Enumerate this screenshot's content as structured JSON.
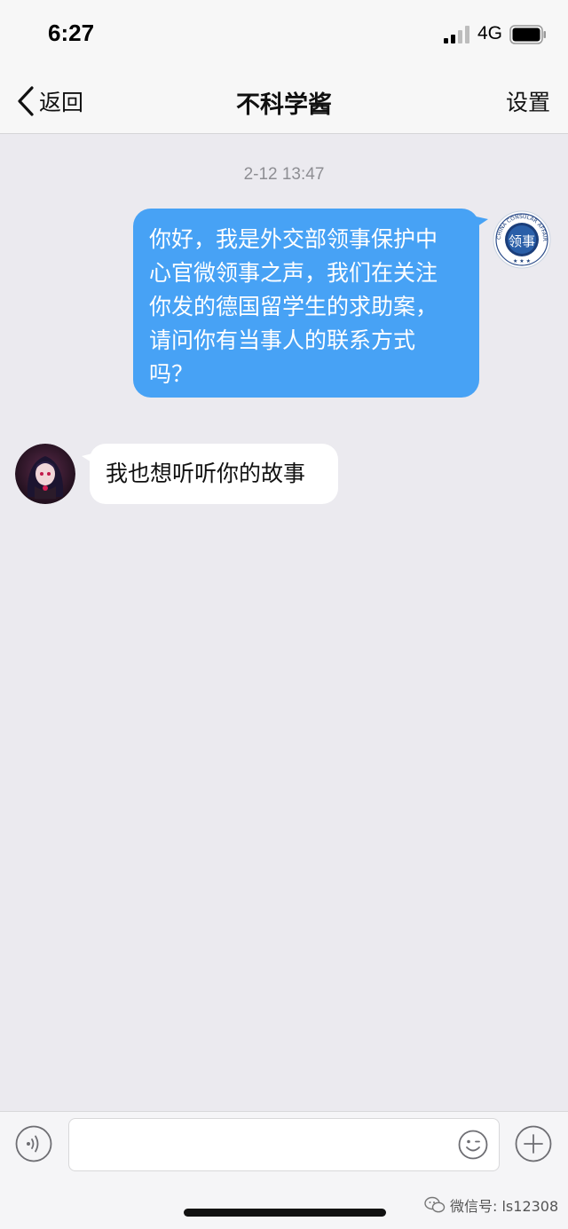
{
  "status_bar": {
    "time": "6:27",
    "network": "4G",
    "signal_icon": "signal-bars-icon",
    "battery_icon": "battery-icon"
  },
  "nav": {
    "back_label": "返回",
    "title": "不科学酱",
    "settings_label": "设置"
  },
  "chat": {
    "timestamp": "2-12 13:47",
    "messages": [
      {
        "direction": "outgoing",
        "lines": [
          "你好，我是外交部领事保护中",
          "心官微领事之声，我们在关注",
          "你发的德国留学生的求助案，",
          "请问你有当事人的联系方式",
          "吗？"
        ],
        "avatar": "consular-affairs-logo",
        "avatar_text": "CHINA CONSULAR AFFAIRS",
        "avatar_char": "领事"
      },
      {
        "direction": "incoming",
        "text": "我也想听听你的故事",
        "avatar": "anime-girl-avatar"
      }
    ]
  },
  "input_bar": {
    "placeholder": "",
    "voice_icon": "voice-icon",
    "emoji_icon": "emoji-icon",
    "plus_icon": "plus-icon"
  },
  "watermark": {
    "text": "微信号: ls12308"
  },
  "colors": {
    "outgoing_bubble": "#47a2f5",
    "incoming_bubble": "#ffffff",
    "chat_background": "#ebeaef"
  }
}
